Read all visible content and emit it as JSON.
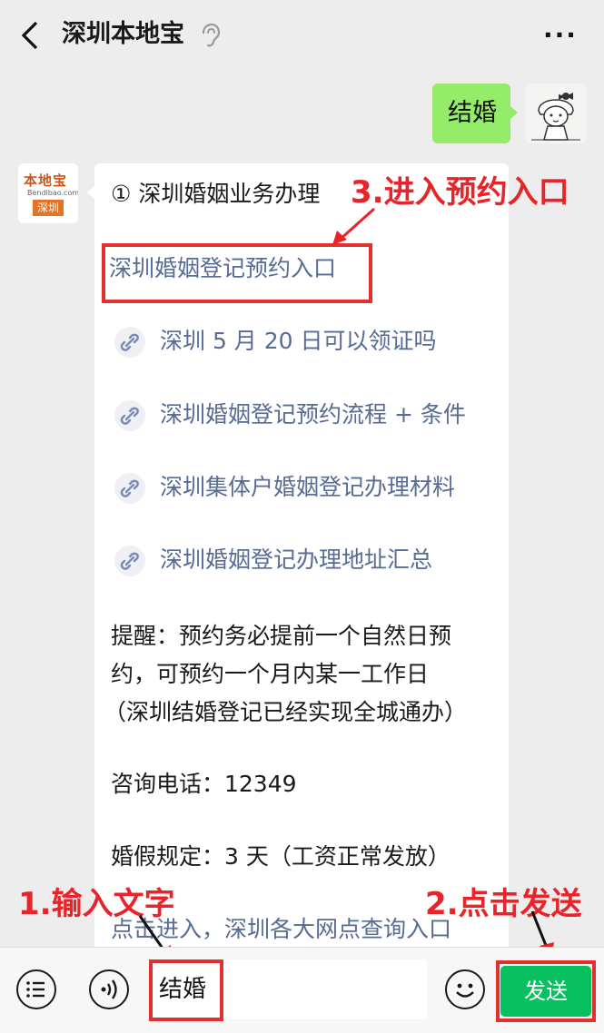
{
  "header": {
    "title": "深圳本地宝",
    "back_icon": "chevron-left-icon",
    "mute_icon": "ear-icon",
    "more_label": "···"
  },
  "user_message": {
    "text": "结婚"
  },
  "bot_logo": {
    "name": "本地宝",
    "sub": "Bendibao.com",
    "tag": "深圳"
  },
  "bot_message": {
    "heading": "① 深圳婚姻业务办理",
    "primary_link": "深圳婚姻登记预约入口",
    "links": [
      "深圳 5 月 20 日可以领证吗",
      "深圳婚姻登记预约流程 + 条件",
      "深圳集体户婚姻登记办理材料",
      "深圳婚姻登记办理地址汇总"
    ],
    "reminder": [
      "提醒：预约务必提前一个自然日预",
      "约，可预约一个月内某一工作日",
      "（深圳结婚登记已经实现全城通办）"
    ],
    "phone": "咨询电话：12349",
    "leave": "婚假规定：3 天（工资正常发放）",
    "query_link": "点击进入，深圳各大网点查询入口"
  },
  "annotations": {
    "step1": "1.输入文字",
    "step2": "2.点击发送",
    "step3": "3.进入预约入口",
    "accent_color": "#e8242a"
  },
  "input_bar": {
    "menu_icon": "menu-list-icon",
    "voice_icon": "voice-icon",
    "input_value": "结婚",
    "emoji_icon": "emoji-icon",
    "send_label": "发送"
  }
}
